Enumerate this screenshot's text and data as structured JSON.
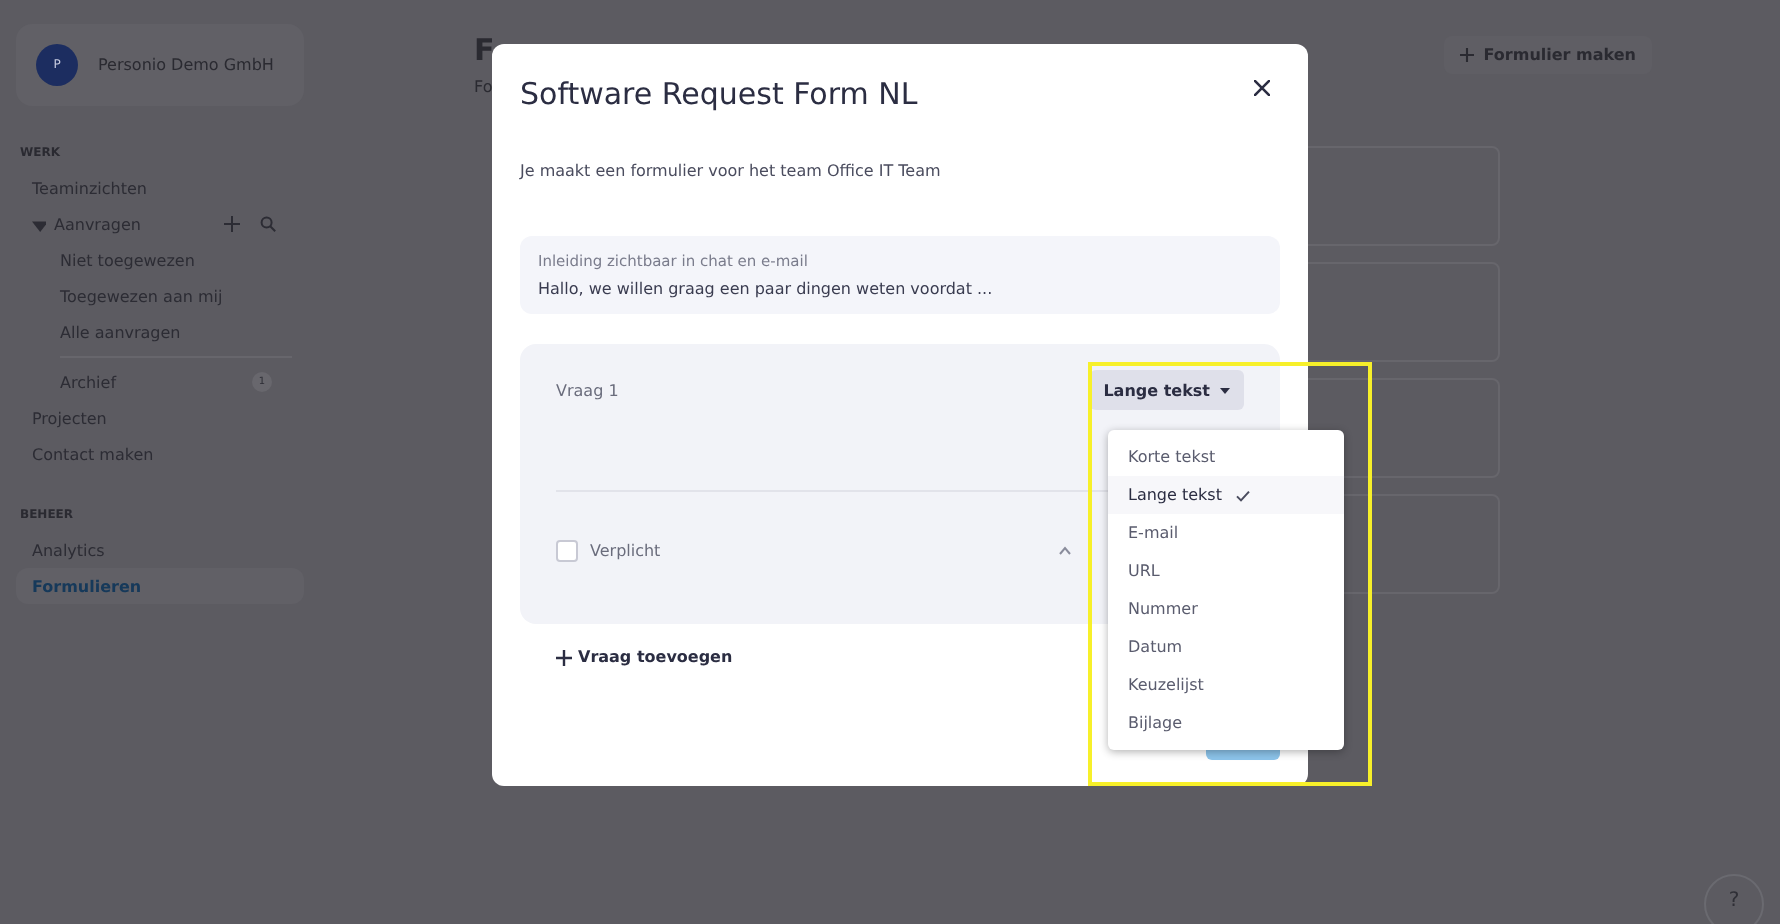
{
  "sidebar": {
    "company": {
      "initial": "P",
      "name": "Personio Demo GmbH"
    },
    "sections": [
      {
        "heading": "WERK",
        "items": [
          {
            "label": "Teaminzichten",
            "selected": false
          },
          {
            "label": "Aanvragen",
            "selected": false,
            "expanded": true,
            "children": [
              {
                "label": "Niet toegewezen",
                "selected": false
              },
              {
                "label": "Toegewezen aan mij",
                "selected": false
              },
              {
                "label": "Alle aanvragen",
                "selected": false
              },
              {
                "label": "Archief",
                "selected": false,
                "badge": "1"
              }
            ]
          },
          {
            "label": "Projecten",
            "selected": false
          },
          {
            "label": "Contact maken",
            "selected": false
          }
        ]
      },
      {
        "heading": "BEHEER",
        "items": [
          {
            "label": "Analytics",
            "selected": false
          },
          {
            "label": "Formulieren",
            "selected": true
          }
        ]
      }
    ]
  },
  "page": {
    "title": "F",
    "subtitle": "Fo",
    "create_button": "Formulier maken"
  },
  "modal": {
    "title": "Software Request Form NL",
    "description": "Je maakt een formulier voor het team Office IT Team",
    "intro": {
      "label": "Inleiding zichtbaar in chat en e-mail",
      "value": "Hallo, we willen graag een paar dingen weten voordat ..."
    },
    "question": {
      "label": "Vraag 1",
      "type": "Lange tekst",
      "required": false,
      "required_label": "Verplicht"
    },
    "add_question": "Vraag toevoegen",
    "type_menu": [
      {
        "label": "Korte tekst",
        "selected": false
      },
      {
        "label": "Lange tekst",
        "selected": true
      },
      {
        "label": "E-mail",
        "selected": false
      },
      {
        "label": "URL",
        "selected": false
      },
      {
        "label": "Nummer",
        "selected": false
      },
      {
        "label": "Datum",
        "selected": false
      },
      {
        "label": "Keuzelijst",
        "selected": false
      },
      {
        "label": "Bijlage",
        "selected": false
      }
    ]
  },
  "help": "?"
}
